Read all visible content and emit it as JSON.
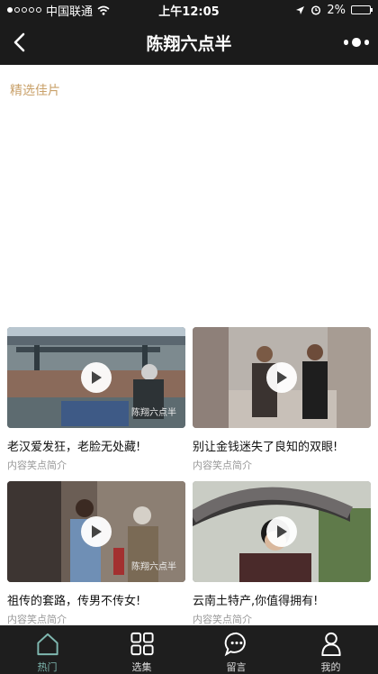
{
  "status_bar": {
    "carrier": "中国联通",
    "time": "上午12:05",
    "battery": "2%"
  },
  "nav": {
    "title": "陈翔六点半"
  },
  "section": {
    "title": "精选佳片"
  },
  "videos": [
    {
      "title": "老汉爱发狂，老脸无处藏!",
      "subtitle": "内容笑点简介",
      "watermark": "陈翔六点半"
    },
    {
      "title": "别让金钱迷失了良知的双眼!",
      "subtitle": "内容笑点简介",
      "watermark": ""
    },
    {
      "title": "祖传的套路，传男不传女!",
      "subtitle": "内容笑点简介",
      "watermark": "陈翔六点半"
    },
    {
      "title": "云南土特产,你值得拥有!",
      "subtitle": "内容笑点简介",
      "watermark": ""
    }
  ],
  "tabs": [
    {
      "label": "热门",
      "icon": "home-icon"
    },
    {
      "label": "选集",
      "icon": "grid-icon"
    },
    {
      "label": "留言",
      "icon": "chat-icon"
    },
    {
      "label": "我的",
      "icon": "person-icon"
    }
  ],
  "colors": {
    "accent_gold": "#c9a16a",
    "active_tab": "#7fb8b0",
    "bar_bg": "#1b1b1b"
  }
}
